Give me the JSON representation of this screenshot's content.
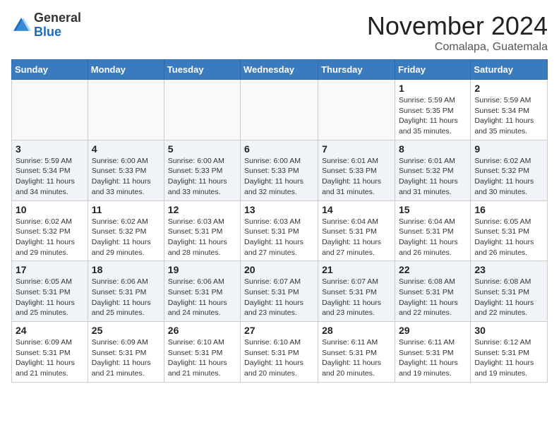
{
  "header": {
    "logo_general": "General",
    "logo_blue": "Blue",
    "month_title": "November 2024",
    "location": "Comalapa, Guatemala"
  },
  "days_of_week": [
    "Sunday",
    "Monday",
    "Tuesday",
    "Wednesday",
    "Thursday",
    "Friday",
    "Saturday"
  ],
  "weeks": [
    [
      {
        "day": "",
        "info": ""
      },
      {
        "day": "",
        "info": ""
      },
      {
        "day": "",
        "info": ""
      },
      {
        "day": "",
        "info": ""
      },
      {
        "day": "",
        "info": ""
      },
      {
        "day": "1",
        "info": "Sunrise: 5:59 AM\nSunset: 5:35 PM\nDaylight: 11 hours\nand 35 minutes."
      },
      {
        "day": "2",
        "info": "Sunrise: 5:59 AM\nSunset: 5:34 PM\nDaylight: 11 hours\nand 35 minutes."
      }
    ],
    [
      {
        "day": "3",
        "info": "Sunrise: 5:59 AM\nSunset: 5:34 PM\nDaylight: 11 hours\nand 34 minutes."
      },
      {
        "day": "4",
        "info": "Sunrise: 6:00 AM\nSunset: 5:33 PM\nDaylight: 11 hours\nand 33 minutes."
      },
      {
        "day": "5",
        "info": "Sunrise: 6:00 AM\nSunset: 5:33 PM\nDaylight: 11 hours\nand 33 minutes."
      },
      {
        "day": "6",
        "info": "Sunrise: 6:00 AM\nSunset: 5:33 PM\nDaylight: 11 hours\nand 32 minutes."
      },
      {
        "day": "7",
        "info": "Sunrise: 6:01 AM\nSunset: 5:33 PM\nDaylight: 11 hours\nand 31 minutes."
      },
      {
        "day": "8",
        "info": "Sunrise: 6:01 AM\nSunset: 5:32 PM\nDaylight: 11 hours\nand 31 minutes."
      },
      {
        "day": "9",
        "info": "Sunrise: 6:02 AM\nSunset: 5:32 PM\nDaylight: 11 hours\nand 30 minutes."
      }
    ],
    [
      {
        "day": "10",
        "info": "Sunrise: 6:02 AM\nSunset: 5:32 PM\nDaylight: 11 hours\nand 29 minutes."
      },
      {
        "day": "11",
        "info": "Sunrise: 6:02 AM\nSunset: 5:32 PM\nDaylight: 11 hours\nand 29 minutes."
      },
      {
        "day": "12",
        "info": "Sunrise: 6:03 AM\nSunset: 5:31 PM\nDaylight: 11 hours\nand 28 minutes."
      },
      {
        "day": "13",
        "info": "Sunrise: 6:03 AM\nSunset: 5:31 PM\nDaylight: 11 hours\nand 27 minutes."
      },
      {
        "day": "14",
        "info": "Sunrise: 6:04 AM\nSunset: 5:31 PM\nDaylight: 11 hours\nand 27 minutes."
      },
      {
        "day": "15",
        "info": "Sunrise: 6:04 AM\nSunset: 5:31 PM\nDaylight: 11 hours\nand 26 minutes."
      },
      {
        "day": "16",
        "info": "Sunrise: 6:05 AM\nSunset: 5:31 PM\nDaylight: 11 hours\nand 26 minutes."
      }
    ],
    [
      {
        "day": "17",
        "info": "Sunrise: 6:05 AM\nSunset: 5:31 PM\nDaylight: 11 hours\nand 25 minutes."
      },
      {
        "day": "18",
        "info": "Sunrise: 6:06 AM\nSunset: 5:31 PM\nDaylight: 11 hours\nand 25 minutes."
      },
      {
        "day": "19",
        "info": "Sunrise: 6:06 AM\nSunset: 5:31 PM\nDaylight: 11 hours\nand 24 minutes."
      },
      {
        "day": "20",
        "info": "Sunrise: 6:07 AM\nSunset: 5:31 PM\nDaylight: 11 hours\nand 23 minutes."
      },
      {
        "day": "21",
        "info": "Sunrise: 6:07 AM\nSunset: 5:31 PM\nDaylight: 11 hours\nand 23 minutes."
      },
      {
        "day": "22",
        "info": "Sunrise: 6:08 AM\nSunset: 5:31 PM\nDaylight: 11 hours\nand 22 minutes."
      },
      {
        "day": "23",
        "info": "Sunrise: 6:08 AM\nSunset: 5:31 PM\nDaylight: 11 hours\nand 22 minutes."
      }
    ],
    [
      {
        "day": "24",
        "info": "Sunrise: 6:09 AM\nSunset: 5:31 PM\nDaylight: 11 hours\nand 21 minutes."
      },
      {
        "day": "25",
        "info": "Sunrise: 6:09 AM\nSunset: 5:31 PM\nDaylight: 11 hours\nand 21 minutes."
      },
      {
        "day": "26",
        "info": "Sunrise: 6:10 AM\nSunset: 5:31 PM\nDaylight: 11 hours\nand 21 minutes."
      },
      {
        "day": "27",
        "info": "Sunrise: 6:10 AM\nSunset: 5:31 PM\nDaylight: 11 hours\nand 20 minutes."
      },
      {
        "day": "28",
        "info": "Sunrise: 6:11 AM\nSunset: 5:31 PM\nDaylight: 11 hours\nand 20 minutes."
      },
      {
        "day": "29",
        "info": "Sunrise: 6:11 AM\nSunset: 5:31 PM\nDaylight: 11 hours\nand 19 minutes."
      },
      {
        "day": "30",
        "info": "Sunrise: 6:12 AM\nSunset: 5:31 PM\nDaylight: 11 hours\nand 19 minutes."
      }
    ]
  ]
}
